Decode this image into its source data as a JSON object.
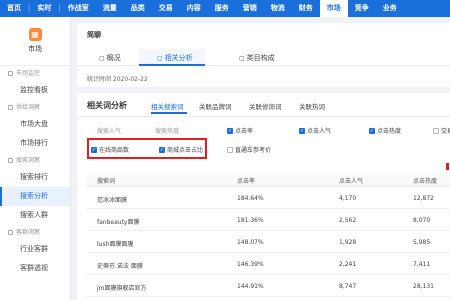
{
  "topnav": {
    "items": [
      {
        "label": "首页",
        "active": false
      },
      {
        "label": "实时",
        "active": false
      },
      {
        "label": "作战室",
        "active": false
      },
      {
        "label": "流量",
        "active": false
      },
      {
        "label": "品类",
        "active": false
      },
      {
        "label": "交易",
        "active": false
      },
      {
        "label": "内容",
        "active": false
      },
      {
        "label": "服务",
        "active": false
      },
      {
        "label": "营销",
        "active": false
      },
      {
        "label": "物流",
        "active": false
      },
      {
        "label": "财务",
        "active": false
      },
      {
        "label": "市场",
        "active": true
      },
      {
        "label": "竞争",
        "active": false
      },
      {
        "label": "业务",
        "active": false
      }
    ],
    "separator": "|"
  },
  "sidebar": {
    "head_label": "市场",
    "head_icon": "market-icon",
    "groups": [
      {
        "label": "市场监控",
        "items": [
          {
            "label": "监控看板",
            "active": false
          }
        ]
      },
      {
        "label": "供给洞察",
        "items": [
          {
            "label": "市场大盘",
            "active": false
          },
          {
            "label": "市场排行",
            "active": false
          }
        ]
      },
      {
        "label": "搜索洞察",
        "items": [
          {
            "label": "搜索排行",
            "active": false
          },
          {
            "label": "搜索分析",
            "active": true
          },
          {
            "label": "搜索人群",
            "active": false
          }
        ]
      },
      {
        "label": "客群洞察",
        "items": [
          {
            "label": "行业客群",
            "active": false
          },
          {
            "label": "客群透视",
            "active": false
          }
        ]
      }
    ]
  },
  "header": {
    "title": "简聊",
    "tabs": [
      {
        "label": "概况",
        "icon": "doc-icon",
        "active": false
      },
      {
        "label": "相关分析",
        "icon": "doc-icon",
        "active": true
      },
      {
        "label": "类目构成",
        "icon": "doc-icon",
        "active": false
      }
    ],
    "stat_time": "统计时间 2020-02-22"
  },
  "section": {
    "title": "相关词分析",
    "tabs": [
      {
        "label": "相关搜索词",
        "active": true
      },
      {
        "label": "关联品牌词",
        "active": false
      },
      {
        "label": "关联修饰词",
        "active": false
      },
      {
        "label": "关联热词",
        "active": false
      }
    ]
  },
  "metrics": {
    "row1": [
      {
        "label": "搜索人气",
        "checked": true
      },
      {
        "label": "搜索热度",
        "checked": false
      },
      {
        "label": "点击率",
        "checked": true
      },
      {
        "label": "点击人气",
        "checked": true
      },
      {
        "label": "点击热度",
        "checked": true
      },
      {
        "label": "交易",
        "checked": false
      }
    ],
    "row2": [
      {
        "label": "在线商品数",
        "checked": true
      },
      {
        "label": "商城点击占比",
        "checked": true
      },
      {
        "label": "直通车参考价",
        "checked": false
      }
    ]
  },
  "table": {
    "headers": [
      "搜索词",
      "点击率",
      "点击人气",
      "点击热度"
    ],
    "rows": [
      {
        "keyword": "范冰冰面膜",
        "ctr": "184.64%",
        "popularity": "4,170",
        "heat": "12,872"
      },
      {
        "keyword": "fanbeauty面膜",
        "ctr": "181.36%",
        "popularity": "2,562",
        "heat": "8,070"
      },
      {
        "keyword": "lush面膜面膜",
        "ctr": "148.07%",
        "popularity": "1,928",
        "heat": "5,985"
      },
      {
        "keyword": "史蒂芬.诺法 面膜",
        "ctr": "146.39%",
        "popularity": "2,241",
        "heat": "7,411"
      },
      {
        "keyword": "jm面膜旗舰店官方",
        "ctr": "144.91%",
        "popularity": "8,747",
        "heat": "28,131"
      }
    ]
  },
  "colors": {
    "accent": "#1a6fdb",
    "highlight": "#e02020",
    "sidebar_icon": "#ff8a3d"
  }
}
